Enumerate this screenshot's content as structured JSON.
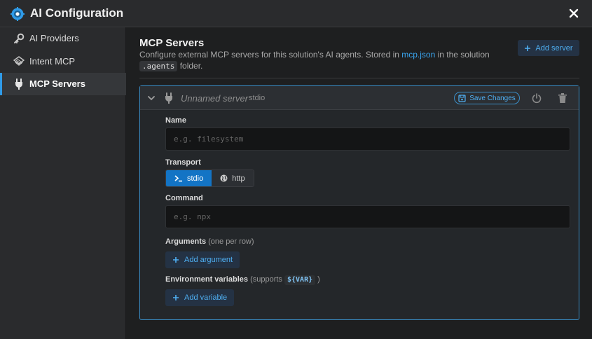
{
  "window": {
    "title": "AI Configuration",
    "app_icon": "gear-sparkle-icon",
    "close_icon": "close-icon"
  },
  "sidebar": {
    "items": [
      {
        "label": "AI Providers",
        "icon": "key-icon",
        "active": false
      },
      {
        "label": "Intent MCP",
        "icon": "layers-icon",
        "active": false
      },
      {
        "label": "MCP Servers",
        "icon": "plug-icon",
        "active": true
      }
    ]
  },
  "main": {
    "title": "MCP Servers",
    "desc_prefix": "Configure external MCP servers for this solution's AI agents. Stored in ",
    "desc_link": "mcp.json",
    "desc_middle": " in the solution ",
    "desc_code": ".agents",
    "desc_suffix": " folder.",
    "add_server_label": "Add server"
  },
  "server": {
    "name": "Unnamed server",
    "type": "stdio",
    "save_label": "Save Changes",
    "fields": {
      "name_label": "Name",
      "name_placeholder": "e.g. filesystem",
      "name_value": "",
      "transport_label": "Transport",
      "transport_options": [
        "stdio",
        "http"
      ],
      "transport_selected": "stdio",
      "command_label": "Command",
      "command_placeholder": "e.g. npx",
      "command_value": "",
      "arguments_label": "Arguments",
      "arguments_hint": "(one per row)",
      "add_argument_label": "Add argument",
      "env_label": "Environment variables",
      "env_hint_prefix": "(supports ",
      "env_hint_code": "${VAR}",
      "env_hint_suffix": ")",
      "add_variable_label": "Add variable"
    }
  },
  "colors": {
    "accent": "#2f9be8",
    "link": "#3aa5ef",
    "active_segment": "#1374c5",
    "background": "#1e1f20",
    "sidebar": "#2a2b2d"
  }
}
